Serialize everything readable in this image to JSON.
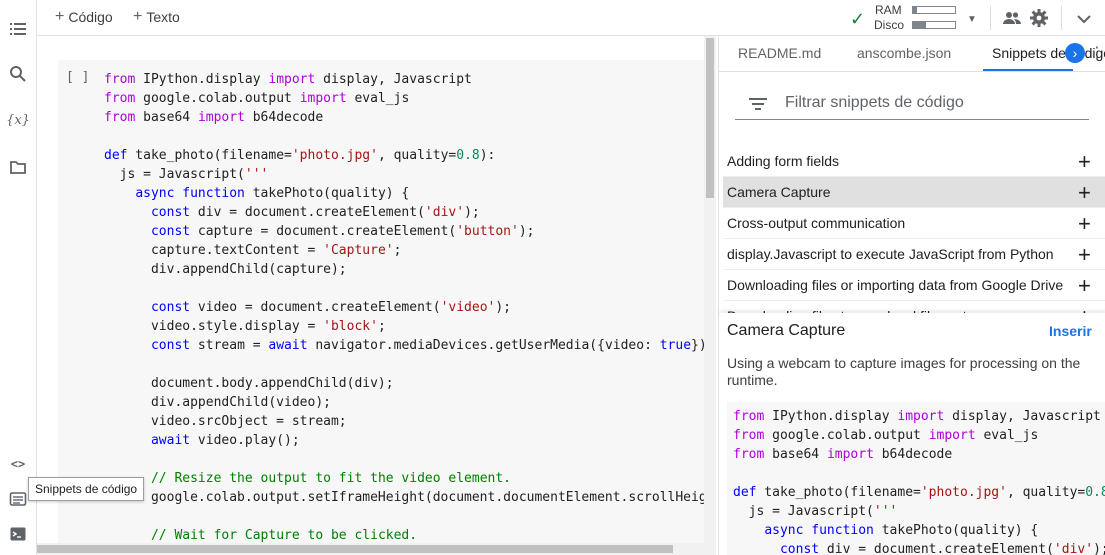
{
  "toolbar": {
    "add_code": "Código",
    "add_text": "Texto",
    "ram_label": "RAM",
    "disk_label": "Disco",
    "ram_usage": 0.1,
    "disk_usage": 0.3
  },
  "rail_icons": [
    "table-of-contents-icon",
    "search-icon",
    "variables-icon",
    "files-icon",
    "code-snippets-icon",
    "command-palette-icon",
    "terminal-icon"
  ],
  "cell": {
    "run_marker": "[ ]"
  },
  "tooltip": "Snippets de código",
  "panel": {
    "tabs": [
      "README.md",
      "anscombe.json",
      "Snippets de código"
    ],
    "filter_placeholder": "Filtrar snippets de código",
    "snippets": [
      "Adding form fields",
      "Camera Capture",
      "Cross-output communication",
      "display.Javascript to execute JavaScript from Python",
      "Downloading files or importing data from Google Drive",
      "Downloading files to your local file system"
    ],
    "selected": "Camera Capture",
    "insert_label": "Inserir",
    "description": "Using a webcam to capture images for processing on the runtime."
  },
  "colors": {
    "accent": "#1a73e8",
    "ok": "#188038",
    "keyword": "#af00db",
    "keyword_blue": "#0000ff",
    "string": "#a31515",
    "number": "#098658",
    "comment": "#008000"
  }
}
